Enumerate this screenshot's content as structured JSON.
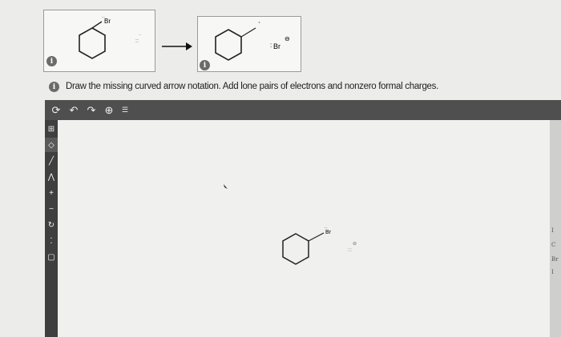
{
  "question": {
    "instruction": "Draw the missing curved arrow notation. Add lone pairs of electrons and nonzero formal charges."
  },
  "reaction": {
    "reactant_label": "Br",
    "product_ion_label": "Br",
    "charge_symbol": "⊖"
  },
  "toolbar": {
    "tools": [
      "undo-redo-cycle",
      "undo",
      "redo",
      "zoom",
      "template-list"
    ]
  },
  "sidebar": {
    "tools": [
      "select",
      "eraser",
      "bond",
      "chain",
      "charge-plus",
      "charge-minus",
      "curved-arrow",
      "lone-pair",
      "ring"
    ]
  },
  "canvas": {
    "substituent_label": "Br",
    "charge_symbol": "⊖"
  },
  "right_edge": {
    "labels": [
      "I",
      "C",
      "Br",
      "I"
    ]
  },
  "colors": {
    "toolbar": "#4f4f4f",
    "sidebar": "#3f3f3f",
    "canvas": "#f0f0ee",
    "page": "#ececea",
    "info_icon": "#6b6b6b"
  }
}
